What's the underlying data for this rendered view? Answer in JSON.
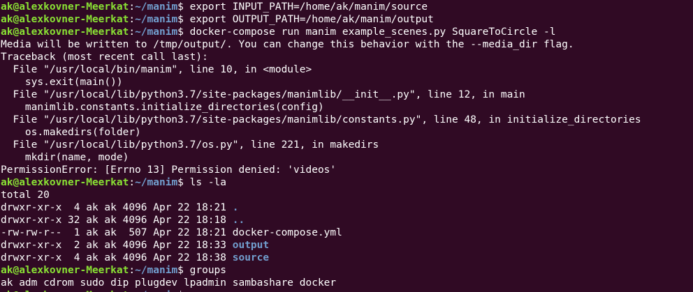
{
  "terminal": {
    "background": "#300a24",
    "colors": {
      "user_host": "#8ae234",
      "path": "#729fcf",
      "text": "#ffffff",
      "directory": "#729fcf"
    },
    "prompt": {
      "user_host": "ak@alexkovner-Meerkat",
      "separator": ":",
      "path": "~/manim",
      "symbol": "$ "
    },
    "lines": [
      {
        "kind": "prompt",
        "command": "export INPUT_PATH=/home/ak/manim/source"
      },
      {
        "kind": "prompt",
        "command": "export OUTPUT_PATH=/home/ak/manim/output"
      },
      {
        "kind": "prompt",
        "command": "docker-compose run manim example_scenes.py SquareToCircle -l"
      },
      {
        "kind": "output",
        "text": "Media will be written to /tmp/output/. You can change this behavior with the --media_dir flag."
      },
      {
        "kind": "output",
        "text": "Traceback (most recent call last):"
      },
      {
        "kind": "output",
        "text": "  File \"/usr/local/bin/manim\", line 10, in <module>"
      },
      {
        "kind": "output",
        "text": "    sys.exit(main())"
      },
      {
        "kind": "output",
        "text": "  File \"/usr/local/lib/python3.7/site-packages/manimlib/__init__.py\", line 12, in main"
      },
      {
        "kind": "output",
        "text": "    manimlib.constants.initialize_directories(config)"
      },
      {
        "kind": "output",
        "text": "  File \"/usr/local/lib/python3.7/site-packages/manimlib/constants.py\", line 48, in initialize_directories"
      },
      {
        "kind": "output",
        "text": "    os.makedirs(folder)"
      },
      {
        "kind": "output",
        "text": "  File \"/usr/local/lib/python3.7/os.py\", line 221, in makedirs"
      },
      {
        "kind": "output",
        "text": "    mkdir(name, mode)"
      },
      {
        "kind": "output",
        "text": "PermissionError: [Errno 13] Permission denied: 'videos'"
      },
      {
        "kind": "prompt",
        "command": "ls -la"
      },
      {
        "kind": "output",
        "text": "total 20"
      },
      {
        "kind": "listing",
        "meta": "drwxr-xr-x  4 ak ak 4096 Apr 22 18:21 ",
        "name": ".",
        "is_dir": true
      },
      {
        "kind": "listing",
        "meta": "drwxr-xr-x 32 ak ak 4096 Apr 22 18:18 ",
        "name": "..",
        "is_dir": true
      },
      {
        "kind": "listing",
        "meta": "-rw-rw-r--  1 ak ak  507 Apr 22 18:21 ",
        "name": "docker-compose.yml",
        "is_dir": false
      },
      {
        "kind": "listing",
        "meta": "drwxr-xr-x  2 ak ak 4096 Apr 22 18:33 ",
        "name": "output",
        "is_dir": true
      },
      {
        "kind": "listing",
        "meta": "drwxr-xr-x  4 ak ak 4096 Apr 22 18:38 ",
        "name": "source",
        "is_dir": true
      },
      {
        "kind": "prompt",
        "command": "groups"
      },
      {
        "kind": "output",
        "text": "ak adm cdrom sudo dip plugdev lpadmin sambashare docker"
      },
      {
        "kind": "prompt_active",
        "command": ""
      }
    ]
  }
}
